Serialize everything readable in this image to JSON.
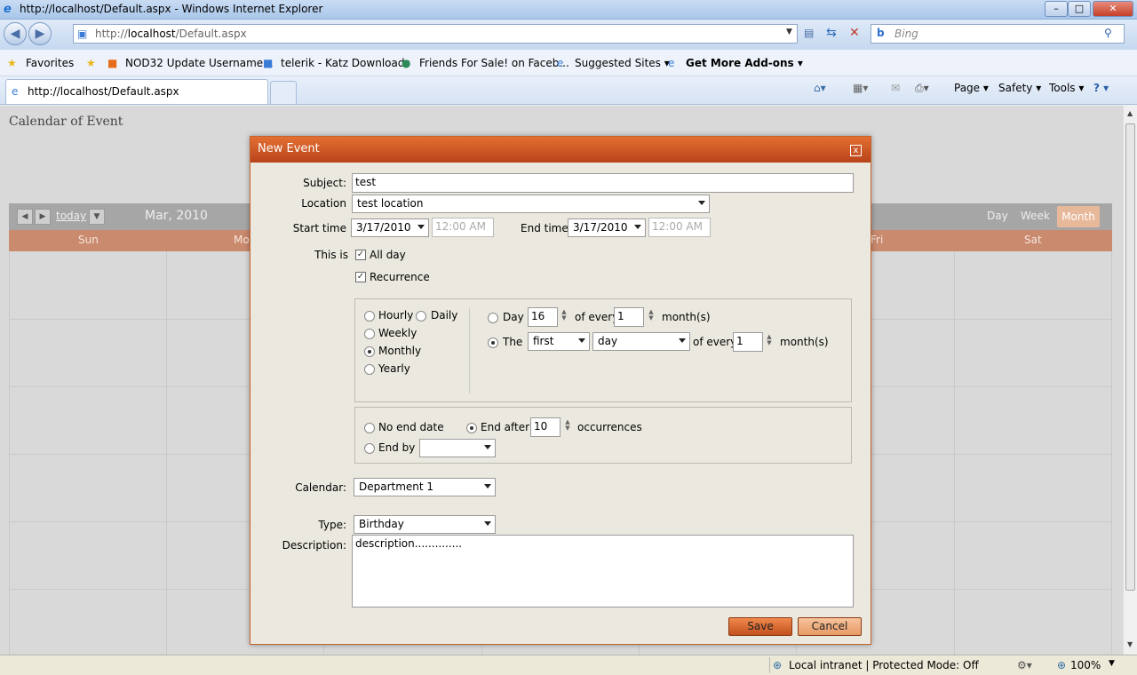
{
  "window": {
    "title": "http://localhost/Default.aspx - Windows Internet Explorer",
    "controls": [
      "–",
      "□",
      "✕"
    ]
  },
  "address": {
    "prefix": "http://",
    "host": "localhost",
    "path": "/Default.aspx",
    "search_placeholder": "Bing"
  },
  "favorites": {
    "label": "Favorites",
    "items": [
      "NOD32 Update  Username...",
      "telerik - Katz Downloads",
      "Friends For Sale! on Faceb...",
      "Suggested Sites ▾",
      "Get More Add-ons ▾"
    ]
  },
  "tabs": {
    "active": "http://localhost/Default.aspx",
    "commands": [
      "Page ▾",
      "Safety ▾",
      "Tools ▾",
      "? ▾"
    ]
  },
  "page": {
    "title": "Calendar of Event",
    "calendar": {
      "today": "today",
      "month": "Mar, 2010",
      "views": [
        "Day",
        "Week",
        "Month"
      ],
      "selected_view": "Month",
      "days": [
        "Sun",
        "Mo",
        "Fri",
        "Sat"
      ]
    }
  },
  "dialog": {
    "title": "New Event",
    "close": "x",
    "subject_label": "Subject:",
    "subject_value": "test",
    "location_label": "Location",
    "location_value": "test location",
    "start_label": "Start time",
    "start_date": "3/17/2010",
    "start_time": "12:00 AM",
    "end_label": "End time",
    "end_date": "3/17/2010",
    "end_time": "12:00 AM",
    "thisis_label": "This is",
    "allday_label": "All day",
    "recurrence_label": "Recurrence",
    "freq": {
      "hourly": "Hourly",
      "daily": "Daily",
      "weekly": "Weekly",
      "monthly": "Monthly",
      "yearly": "Yearly",
      "selected": "Monthly"
    },
    "monthly": {
      "day_label": "Day",
      "day_value": "16",
      "of_every": "of every",
      "every_value1": "1",
      "months": "month(s)",
      "the_label": "The",
      "ordinal": "first",
      "weekday": "day",
      "every_value2": "1"
    },
    "range": {
      "no_end": "No end date",
      "end_after": "End after",
      "occurrences_value": "10",
      "occurrences": "occurrences",
      "end_by": "End by",
      "end_by_value": ""
    },
    "calendar_label": "Calendar:",
    "calendar_value": "Department 1",
    "type_label": "Type:",
    "type_value": "Birthday",
    "description_label": "Description:",
    "description_value": "description..............",
    "save": "Save",
    "cancel": "Cancel"
  },
  "status": {
    "zone": "Local intranet | Protected Mode: Off",
    "zoom": "100%"
  }
}
